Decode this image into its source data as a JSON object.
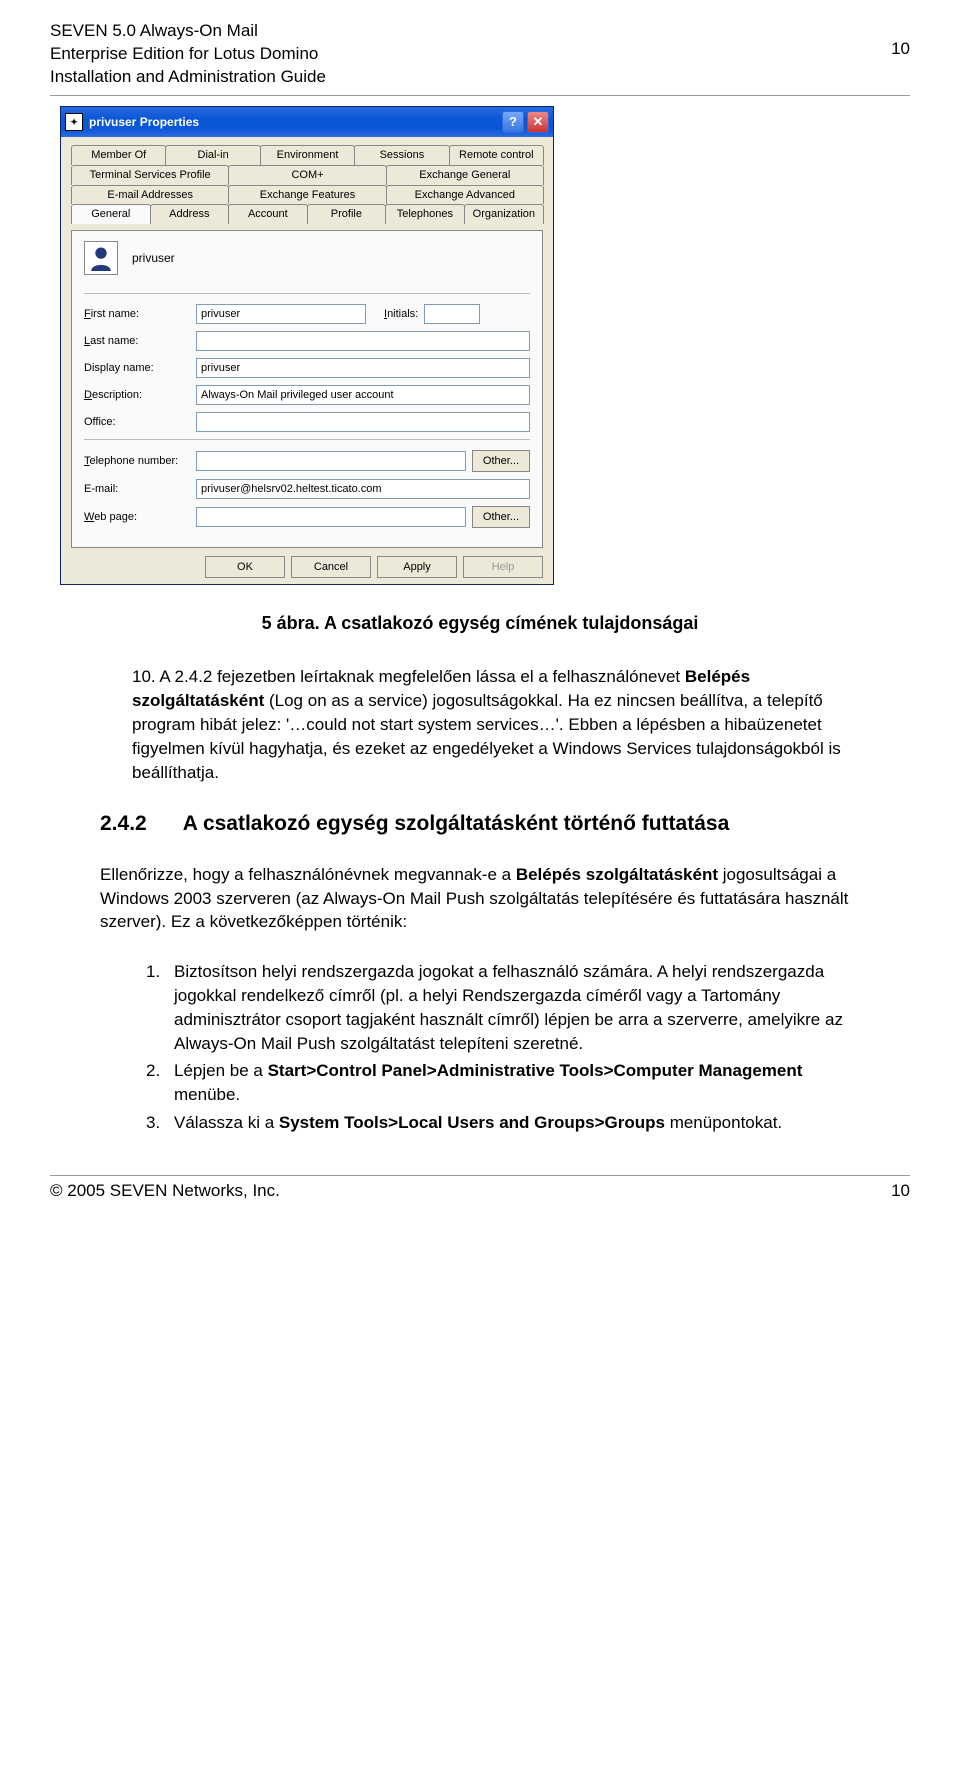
{
  "header": {
    "line1": "SEVEN 5.0 Always-On Mail",
    "line2": "Enterprise Edition for Lotus Domino",
    "line3": "Installation and Administration Guide",
    "page_top": "10"
  },
  "dialog": {
    "title": "privuser Properties",
    "help_glyph": "?",
    "close_glyph": "✕",
    "tabs_row1": [
      "Member Of",
      "Dial-in",
      "Environment",
      "Sessions",
      "Remote control"
    ],
    "tabs_row2": [
      "Terminal Services Profile",
      "COM+",
      "Exchange General"
    ],
    "tabs_row3": [
      "E-mail Addresses",
      "Exchange Features",
      "Exchange Advanced"
    ],
    "tabs_row4": [
      "General",
      "Address",
      "Account",
      "Profile",
      "Telephones",
      "Organization"
    ],
    "username": "privuser",
    "labels": {
      "first_name": "First name:",
      "initials": "Initials:",
      "last_name": "Last name:",
      "display_name": "Display name:",
      "description": "Description:",
      "office": "Office:",
      "telephone": "Telephone number:",
      "email": "E-mail:",
      "webpage": "Web page:"
    },
    "values": {
      "first_name": "privuser",
      "initials": "",
      "last_name": "",
      "display_name": "privuser",
      "description": "Always-On Mail privileged user account",
      "office": "",
      "telephone": "",
      "email": "privuser@helsrv02.heltest.ticato.com",
      "webpage": ""
    },
    "buttons": {
      "other": "Other...",
      "ok": "OK",
      "cancel": "Cancel",
      "apply": "Apply",
      "help": "Help"
    }
  },
  "caption": "5 ábra. A csatlakozó egység címének tulajdonságai",
  "para1_a": "10. A 2.4.2 fejezetben leírtaknak megfelelően lássa el a felhasználónevet ",
  "para1_b": "Belépés szolgáltatásként",
  "para1_c": " (Log on as a service) jogosultságokkal. Ha ez nincsen beállítva, a telepítő program hibát jelez: '…could not start system services…'. Ebben a lépésben a hibaüzenetet figyelmen kívül hagyhatja, és ezeket az engedélyeket a Windows Services tulajdonságokból is beállíthatja.",
  "section": {
    "num": "2.4.2",
    "title": "A csatlakozó egység szolgáltatásként történő futtatása"
  },
  "para2_a": "Ellenőrizze, hogy a felhasználónévnek megvannak-e a ",
  "para2_b": "Belépés szolgáltatásként",
  "para2_c": " jogosultságai a Windows 2003 szerveren (az Always-On Mail Push szolgáltatás telepítésére és futtatására használt szerver). Ez a következőképpen történik:",
  "list": {
    "i1": "Biztosítson helyi rendszergazda jogokat a felhasználó számára. A helyi rendszergazda jogokkal rendelkező címről (pl. a helyi Rendszergazda címéről vagy a Tartomány adminisztrátor csoport tagjaként használt címről) lépjen be arra a szerverre, amelyikre az Always-On Mail Push szolgáltatást telepíteni szeretné.",
    "i2_a": "Lépjen be a ",
    "i2_b": "Start>Control Panel>Administrative Tools>Computer Management",
    "i2_c": " menübe.",
    "i3_a": "Válassza ki a ",
    "i3_b": "System Tools>Local Users and Groups>Groups",
    "i3_c": " menüpontokat."
  },
  "footer": {
    "left": "© 2005 SEVEN Networks, Inc.",
    "right": "10"
  }
}
